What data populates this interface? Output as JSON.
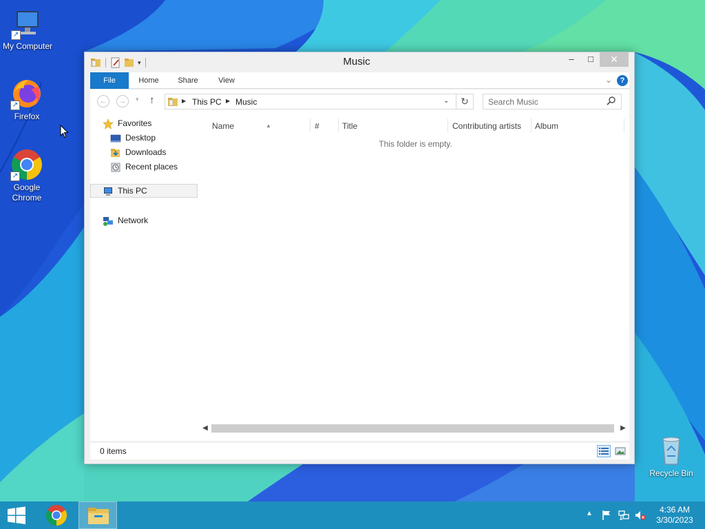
{
  "desktop": {
    "icons": [
      {
        "label": "My Computer"
      },
      {
        "label": "Firefox"
      },
      {
        "label": "Google Chrome"
      },
      {
        "label": "Recycle Bin"
      }
    ]
  },
  "window": {
    "title": "Music",
    "buttons": {
      "minimize": "–",
      "maximize": "□",
      "close": "✕"
    }
  },
  "ribbon": {
    "tabs": [
      "File",
      "Home",
      "Share",
      "View"
    ],
    "help": "?"
  },
  "address": {
    "breadcrumb": [
      "This PC",
      "Music"
    ],
    "search_placeholder": "Search Music"
  },
  "navpane": {
    "favorites": "Favorites",
    "favorites_items": [
      "Desktop",
      "Downloads",
      "Recent places"
    ],
    "this_pc": "This PC",
    "network": "Network"
  },
  "files": {
    "columns": [
      "Name",
      "#",
      "Title",
      "Contributing artists",
      "Album"
    ],
    "empty_message": "This folder is empty."
  },
  "status": {
    "item_count": "0 items"
  },
  "taskbar": {
    "time": "4:36 AM",
    "date": "3/30/2023"
  },
  "colors": {
    "file_tab": "#1979ca",
    "taskbar": "#1e96b9",
    "close_button": "#c7c7c7"
  }
}
